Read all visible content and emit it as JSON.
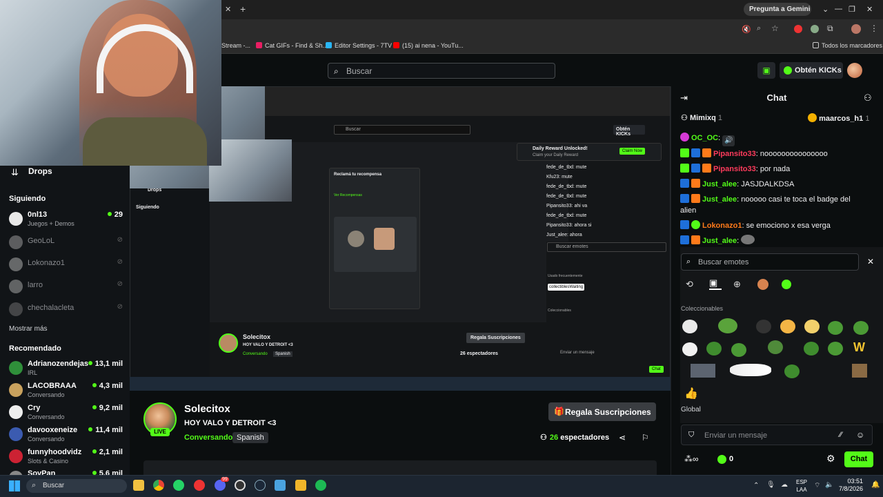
{
  "browser": {
    "gemini_label": "Pregunta a Gemini",
    "bookmarks": [
      "Stream -...",
      "Cat GIFs - Find & Sh...",
      "Editor Settings - 7TV",
      "(15) ai nena - YouTu..."
    ],
    "all_bookmarks": "Todos los marcadores"
  },
  "header": {
    "search_placeholder": "Buscar",
    "kicks_label": "Obtén KICKs"
  },
  "sidebar": {
    "drops": "Drops",
    "following_heading": "Siguiendo",
    "following": [
      {
        "name": "0nl13",
        "sub": "Juegos + Demos",
        "viewers": "29",
        "live": true,
        "color": "#e8e8e8"
      },
      {
        "name": "GeoLoL",
        "sub": "",
        "viewers": "",
        "live": false,
        "color": "#9aa"
      },
      {
        "name": "Lokonazo1",
        "sub": "",
        "viewers": "",
        "live": false,
        "color": "#bbb"
      },
      {
        "name": "larro",
        "sub": "",
        "viewers": "",
        "live": false,
        "color": "#caa"
      },
      {
        "name": "chechalacleta",
        "sub": "",
        "viewers": "",
        "live": false,
        "color": "#777"
      }
    ],
    "show_more": "Mostrar más",
    "recommended_heading": "Recomendado",
    "recommended": [
      {
        "name": "Adrianozendejas",
        "sub": "IRL",
        "viewers": "13,1 mil",
        "color": "#2f8f3a"
      },
      {
        "name": "LACOBRAAA",
        "sub": "Conversando",
        "viewers": "4,3 mil",
        "color": "#c9a25e"
      },
      {
        "name": "Cry",
        "sub": "Conversando",
        "viewers": "9,2 mil",
        "color": "#eee"
      },
      {
        "name": "davooxeneize",
        "sub": "Conversando",
        "viewers": "11,4 mil",
        "color": "#3b5bb0"
      },
      {
        "name": "funnyhoodvidz",
        "sub": "Slots & Casino",
        "viewers": "2,1 mil",
        "color": "#c23"
      },
      {
        "name": "SovPan",
        "sub": "",
        "viewers": "5,6 mil",
        "color": "#888"
      }
    ]
  },
  "stream": {
    "streamer": "Solecitox",
    "title": "HOY VALO Y DETROIT <3",
    "category": "Conversando",
    "language": "Spanish",
    "live_badge": "LIVE",
    "gift_subs": "Regala Suscripciones",
    "viewer_count": "26",
    "viewer_label": "espectadores"
  },
  "nested_screen": {
    "search": "Buscar",
    "kicks": "Obtén KICKs",
    "drops": "Drops",
    "following": "Siguiendo",
    "streamer": "Solecitox",
    "title": "HOY VALO Y DETROIT <3",
    "category": "Conversando",
    "language": "Spanish",
    "gift_subs": "Regala Suscripciones",
    "viewers": "26 espectadores",
    "reward_title": "Daily Reward Unlocked!",
    "reward_sub": "Claim your Daily Reward",
    "claim": "Claim Now",
    "emote_search": "Buscar emotes",
    "frequent": "Usado frecuentemente",
    "tooltip": "collectiblesWaiting",
    "collectibles": "Coleccionables",
    "msg": "Enviar un mensaje",
    "chat_btn": "Chat",
    "chat_lines": [
      "fede_de_tbd: mute",
      "Kfu23: mute",
      "fede_de_tbd: mute",
      "fede_de_tbd: mute",
      "Pipansito33: ahi va",
      "fede_de_tbd: mute",
      "Pipansito33: ahora si",
      "Just_alee: ahora"
    ],
    "claim_panel_title": "Reclamá tu recompensa",
    "claim_panel_link": "Ver Recompensas"
  },
  "chat": {
    "title": "Chat",
    "pinned_left": {
      "user": "Mimixq",
      "count": "1"
    },
    "pinned_right": {
      "user": "maarcos_h1",
      "count": "1"
    },
    "messages": [
      {
        "user": "OC_OC",
        "text": "",
        "color": "#53fc18",
        "badges": [
          "#d63ad6"
        ]
      },
      {
        "user": "Pipansito33",
        "text": ": nooooooooooooooo",
        "color": "#ff3b5c",
        "badges": [
          "#53fc18",
          "#1e6fd9",
          "#ff7a1a"
        ]
      },
      {
        "user": "Pipansito33",
        "text": ": por nada",
        "color": "#ff3b5c",
        "badges": [
          "#53fc18",
          "#1e6fd9",
          "#ff7a1a"
        ]
      },
      {
        "user": "Just_alee",
        "text": ": JASJDALKDSA",
        "color": "#53fc18",
        "badges": [
          "#1e6fd9",
          "#ff7a1a"
        ]
      },
      {
        "user": "Just_alee",
        "text": ": nooooo casi te toca el badge del",
        "color": "#53fc18",
        "badges": [
          "#1e6fd9",
          "#ff7a1a"
        ]
      },
      {
        "user": "",
        "text": "alien",
        "color": "#fff",
        "badges": []
      },
      {
        "user": "Lokonazo1",
        "text": ": se emociono x esa verga",
        "color": "#ff7a1a",
        "badges": [
          "#1e6fd9",
          "#53fc18"
        ]
      },
      {
        "user": "Just_alee",
        "text": ":",
        "color": "#53fc18",
        "badges": [
          "#1e6fd9",
          "#ff7a1a"
        ]
      }
    ],
    "emote_search_placeholder": "Buscar emotes",
    "collectibles_heading": "Coleccionables",
    "global_heading": "Global",
    "message_placeholder": "Enviar un mensaje",
    "points": "0",
    "send_button": "Chat"
  },
  "taskbar": {
    "search": "Buscar",
    "lang_top": "ESP",
    "lang_bottom": "LAA",
    "time": "03:51",
    "date": "7/8/2026",
    "discord_badge": "99"
  }
}
